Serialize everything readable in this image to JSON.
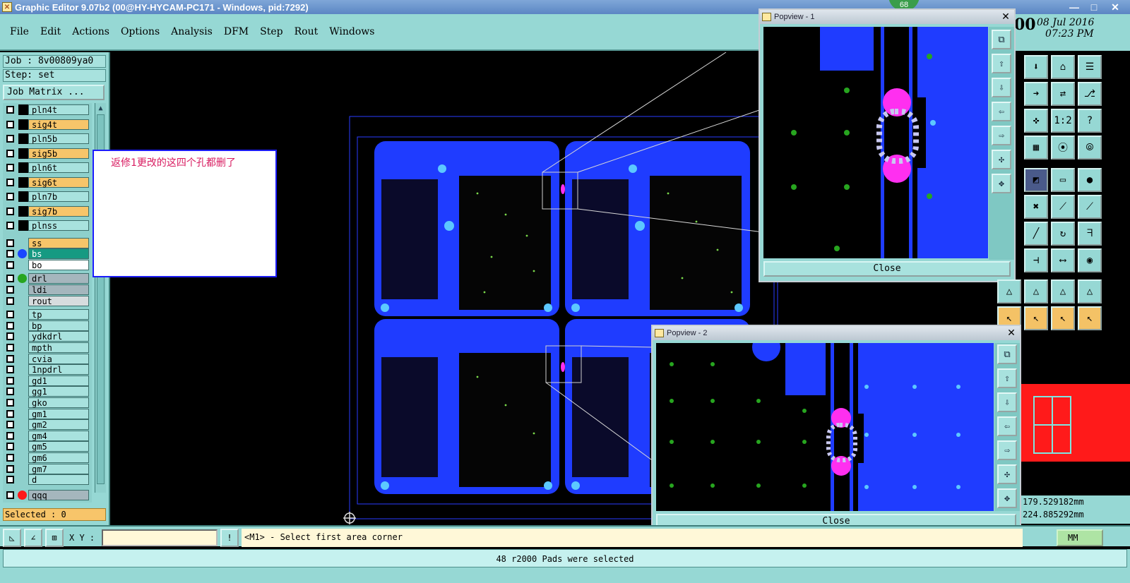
{
  "window": {
    "title": "Graphic Editor 9.07b2 (00@HY-HYCAM-PC171 - Windows, pid:7292)",
    "minimize": "—",
    "maximize": "□",
    "close": "✕",
    "notification_count": "68"
  },
  "menu": [
    "File",
    "Edit",
    "Actions",
    "Options",
    "Analysis",
    "DFM",
    "Step",
    "Rout",
    "Windows"
  ],
  "clock": {
    "time_big": "00",
    "date": "08 Jul 2016",
    "time": "07:23 PM"
  },
  "job": {
    "job_label": "Job : 8v00809ya0",
    "step_label": "Step: set",
    "matrix_button": "Job Matrix ..."
  },
  "layers": [
    {
      "name": "pln4t",
      "style": "cyan",
      "marker": "block"
    },
    {
      "name": "sig4t",
      "style": "orange",
      "marker": "block"
    },
    {
      "name": "pln5b",
      "style": "cyan",
      "marker": "block"
    },
    {
      "name": "sig5b",
      "style": "orange",
      "marker": "block"
    },
    {
      "name": "pln6t",
      "style": "cyan",
      "marker": "block"
    },
    {
      "name": "sig6t",
      "style": "orange",
      "marker": "block"
    },
    {
      "name": "pln7b",
      "style": "cyan",
      "marker": "block"
    },
    {
      "name": "sig7b",
      "style": "orange",
      "marker": "block"
    },
    {
      "name": "plnss",
      "style": "cyan",
      "marker": "block"
    },
    {
      "name": "ss",
      "style": "orange",
      "marker": "none"
    },
    {
      "name": "bs",
      "style": "green",
      "marker": "dot-blue"
    },
    {
      "name": "bo",
      "style": "white",
      "marker": "none"
    },
    {
      "name": "drl",
      "style": "grey",
      "marker": "dot-green"
    },
    {
      "name": "ldi",
      "style": "grey",
      "marker": "none"
    },
    {
      "name": "rout",
      "style": "lightgrey",
      "marker": "none"
    },
    {
      "name": "tp",
      "style": "cyan",
      "marker": "none"
    },
    {
      "name": "bp",
      "style": "cyan",
      "marker": "none"
    },
    {
      "name": "ydkdrl",
      "style": "cyan",
      "marker": "none"
    },
    {
      "name": "mpth",
      "style": "cyan",
      "marker": "none"
    },
    {
      "name": "cvia",
      "style": "cyan",
      "marker": "none"
    },
    {
      "name": "1npdrl",
      "style": "cyan",
      "marker": "none"
    },
    {
      "name": "gd1",
      "style": "cyan",
      "marker": "none"
    },
    {
      "name": "gg1",
      "style": "cyan",
      "marker": "none"
    },
    {
      "name": "gko",
      "style": "cyan",
      "marker": "none"
    },
    {
      "name": "gm1",
      "style": "cyan",
      "marker": "none"
    },
    {
      "name": "gm2",
      "style": "cyan",
      "marker": "none"
    },
    {
      "name": "gm4",
      "style": "cyan",
      "marker": "none"
    },
    {
      "name": "gm5",
      "style": "cyan",
      "marker": "none"
    },
    {
      "name": "gm6",
      "style": "cyan",
      "marker": "none"
    },
    {
      "name": "gm7",
      "style": "cyan",
      "marker": "none"
    },
    {
      "name": "d",
      "style": "cyan",
      "marker": "none"
    },
    {
      "name": "qqq",
      "style": "grey",
      "marker": "dot-red"
    }
  ],
  "selected_label": "Selected : 0",
  "note_text": "返修1更改的这四个孔都删了",
  "popview1": {
    "title": "Popview - 1",
    "close_label": "Close"
  },
  "popview2": {
    "title": "Popview - 2",
    "close_label": "Close"
  },
  "coords": {
    "x": "179.529182mm",
    "y": "224.885292mm"
  },
  "cmd": {
    "xy_label": "X Y :",
    "xy_value": "",
    "prompt": "<M1> - Select first area corner",
    "unit": "MM"
  },
  "status": "48 r2000 Pads were selected",
  "colors": {
    "panel": "#96d8d4",
    "board_blue": "#1f3cff",
    "highlight_magenta": "#ff2ff0",
    "drill_green": "#27a51f",
    "orange_layer": "#f7c56a"
  }
}
